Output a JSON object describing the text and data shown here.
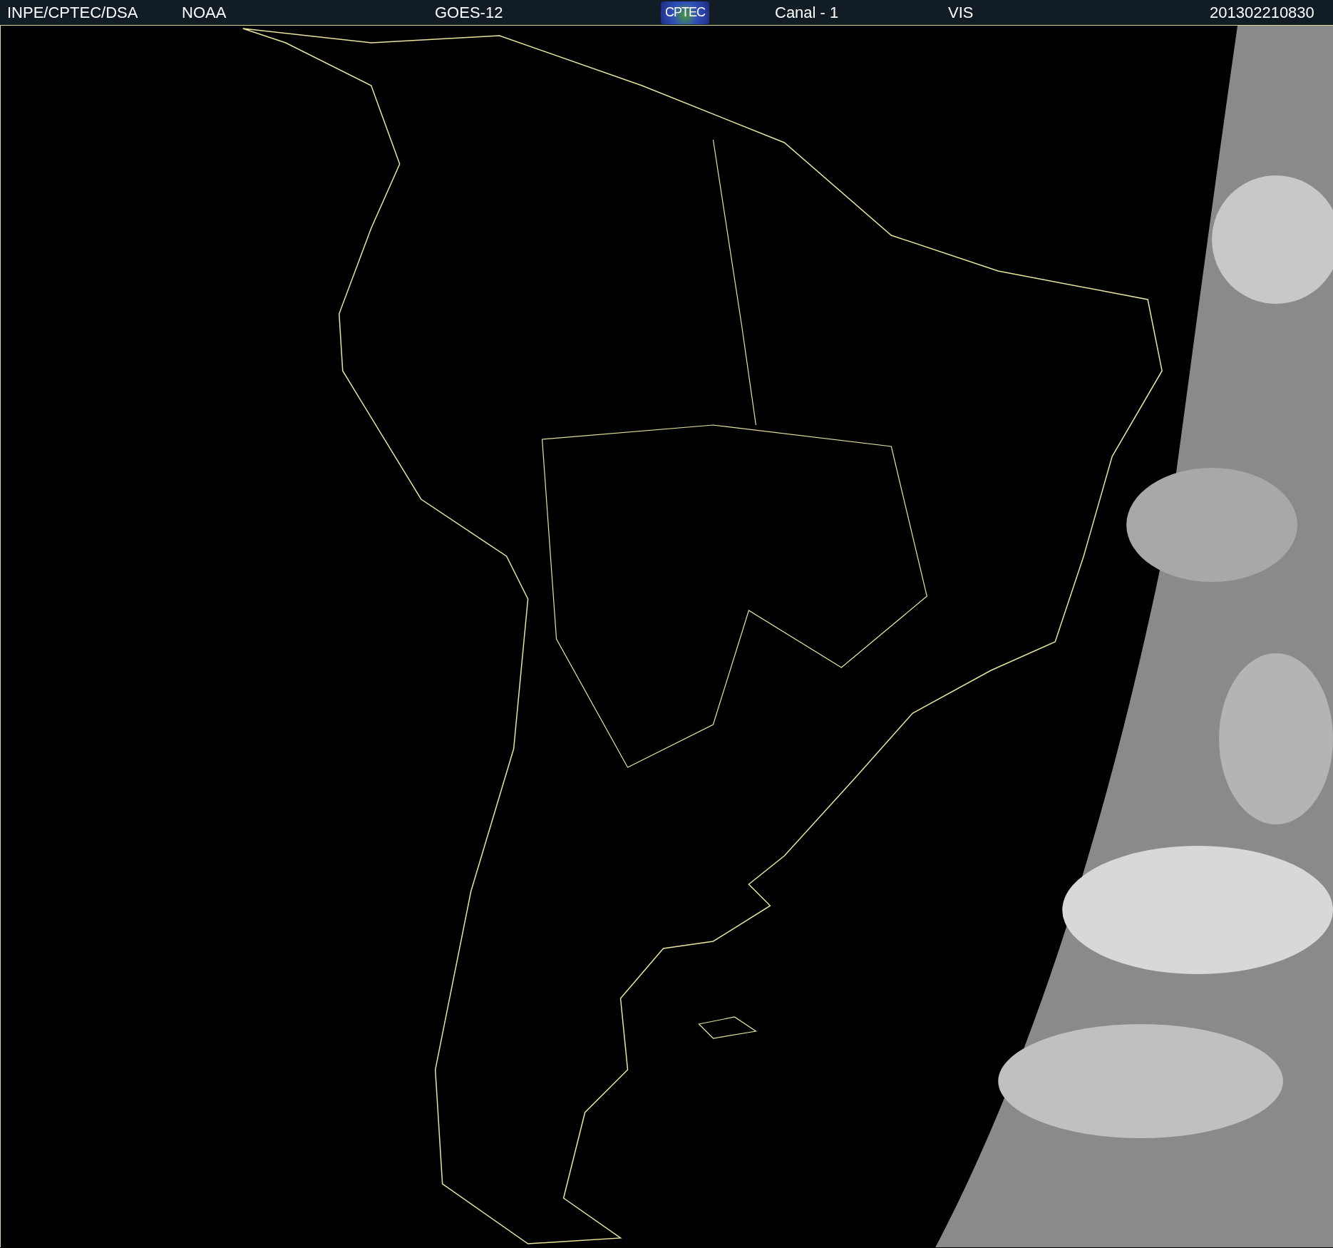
{
  "header": {
    "items": [
      {
        "kind": "text",
        "text": "INPE/CPTEC/DSA"
      },
      {
        "kind": "text",
        "text": "NOAA"
      },
      {
        "kind": "text",
        "text": "GOES-12"
      },
      {
        "kind": "logo",
        "text": "CPTEC"
      },
      {
        "kind": "text",
        "text": "Canal - 1"
      },
      {
        "kind": "text",
        "text": "VIS"
      },
      {
        "kind": "text",
        "text": "201302210830"
      }
    ]
  }
}
